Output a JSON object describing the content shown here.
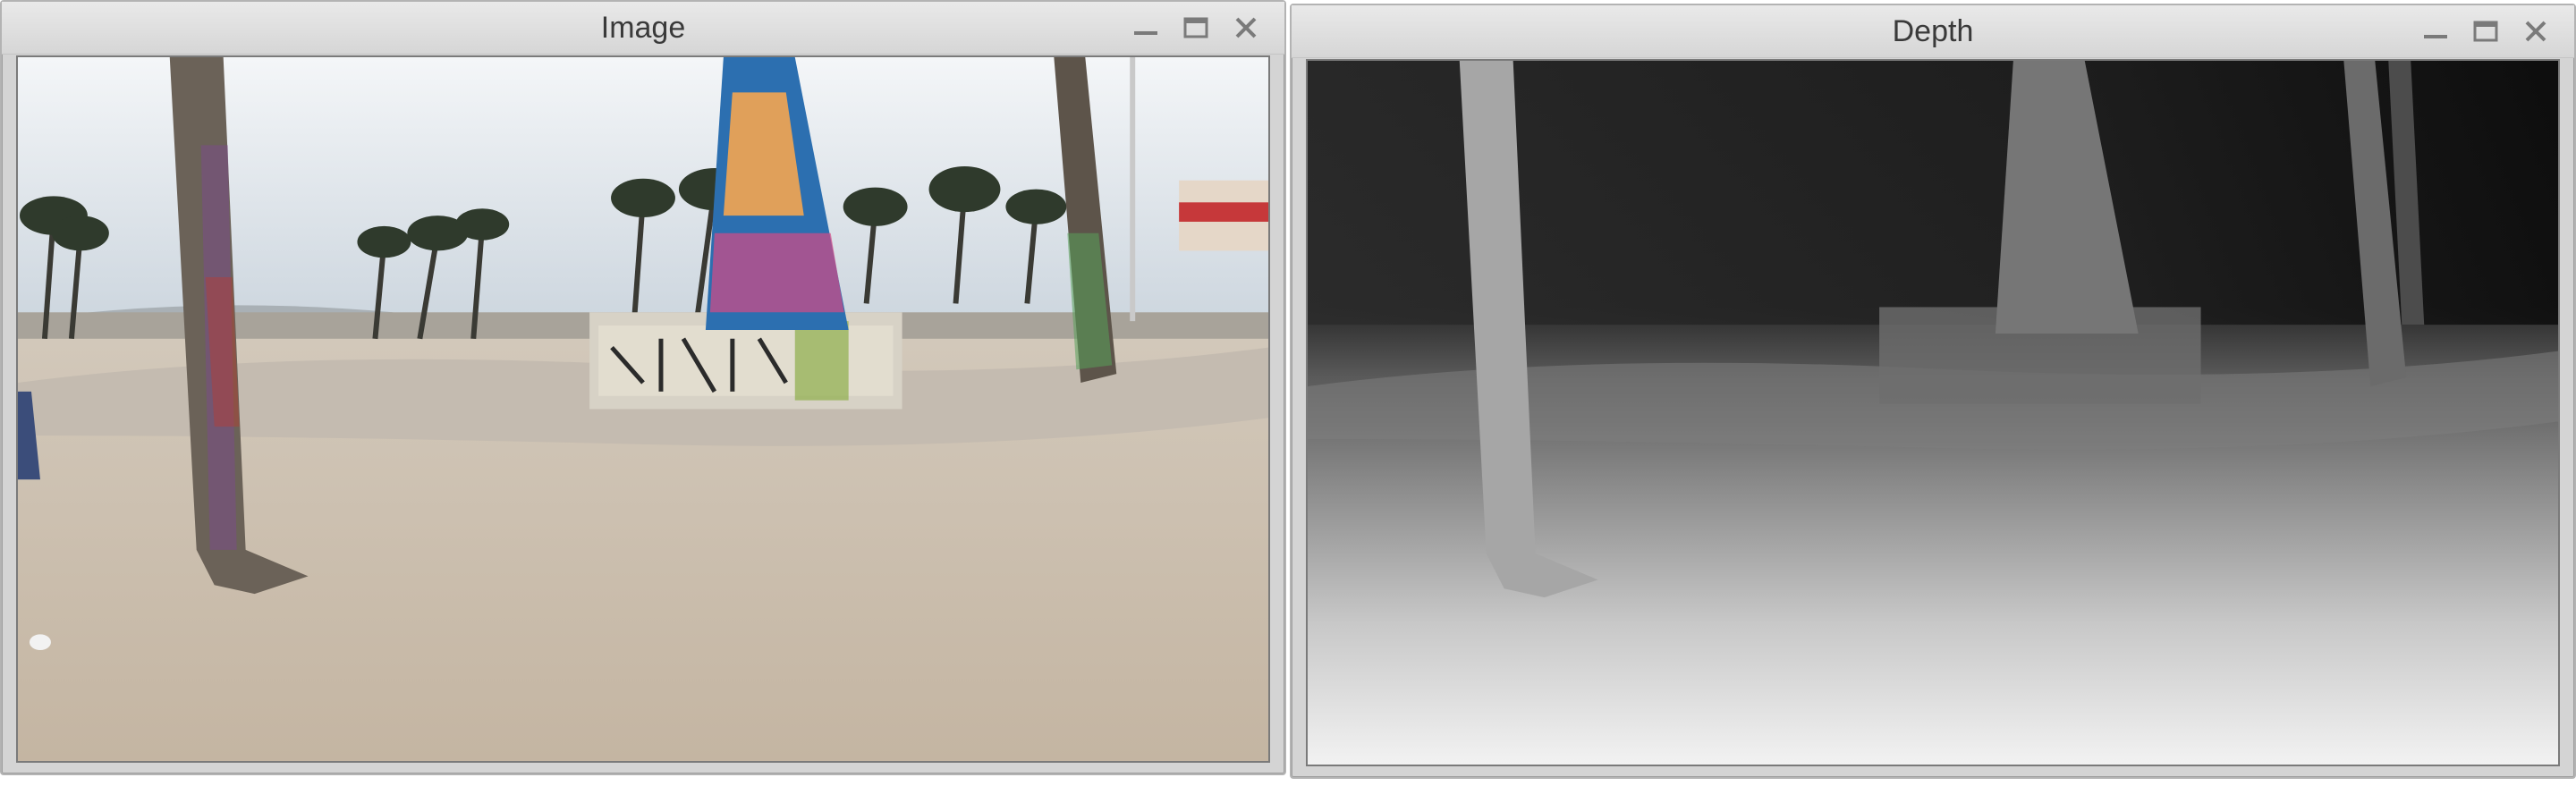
{
  "windows": [
    {
      "title": "Image",
      "controls": [
        "minimize-icon",
        "maximize-icon",
        "close-icon"
      ]
    },
    {
      "title": "Depth",
      "controls": [
        "minimize-icon",
        "maximize-icon",
        "close-icon"
      ]
    }
  ],
  "colors": {
    "sky": "#d9e3ec",
    "sand": "#cfc3b3",
    "path": "#bdb4a8",
    "depth_far": "#141414",
    "depth_near": "#eeeeee"
  }
}
